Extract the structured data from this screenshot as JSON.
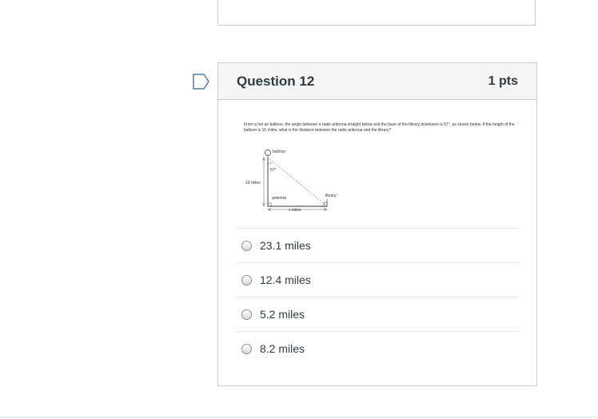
{
  "question": {
    "title": "Question 12",
    "points": "1 pts",
    "prompt": "From a hot air balloon, the angle between a radio antenna straight below and the base of the library downtown is 57°, as shown below. If the height of the balloon is 15 miles, what is the distance between the radio antenna and the library?",
    "diagram_labels": {
      "balloon": "balloon",
      "angle": "57°",
      "height": "15 miles",
      "antenna": "antenna",
      "library": "library",
      "base": "x miles"
    },
    "answers": [
      {
        "label": "23.1 miles"
      },
      {
        "label": "12.4 miles"
      },
      {
        "label": "5.2 miles"
      },
      {
        "label": "8.2 miles"
      }
    ]
  }
}
